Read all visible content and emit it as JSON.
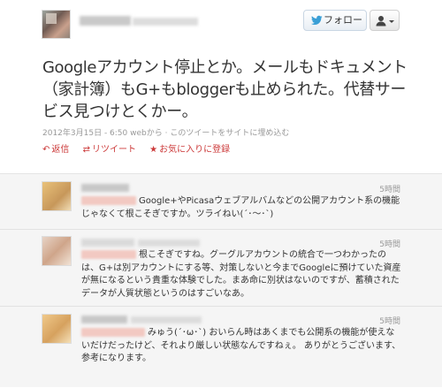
{
  "tweet": {
    "text": "Googleアカウント停止とか。メールもドキュメント（家計簿）もG+もbloggerも止められた。代替サービス見つけとくかー。",
    "meta": "2012年3月15日 - 6:50 webから · このツイートをサイトに埋め込む",
    "follow_label": "フォロー",
    "actions": {
      "reply": "返信",
      "retweet": "リツイート",
      "favorite": "お気に入りに登録"
    }
  },
  "replies": [
    {
      "time": "5時間",
      "text": "Google+やPicasaウェブアルバムなどの公開アカウント系の機能じゃなくて根こそぎですか。ツライねい(´･～･`)"
    },
    {
      "time": "5時間",
      "text": "根こそぎですね。グーグルアカウントの統合で一つわかったのは、G+は別アカウントにする等、対策しないと今までGoogleに預けていた資産が無になるという貴重な体験でした。まあ命に別状はないのですが、蓄積されたデータが人質状態というのはすごいなあ。"
    },
    {
      "time": "5時間",
      "text": "みゅう(´･ω･`) おいらん時はあくまでも公開系の機能が使えないだけだったけど、それより厳しい状態なんですねぇ。 ありがとうございます、参考になります。"
    }
  ],
  "colors": {
    "accent_red": "#cc3a3a",
    "meta_gray": "#999999",
    "reply_bg": "#f5f5f5"
  },
  "icons": {
    "follow": "bird-icon",
    "user_menu": "user-dropdown-icon",
    "reply": "reply-arrow-icon",
    "retweet": "retweet-icon",
    "favorite": "star-icon"
  }
}
